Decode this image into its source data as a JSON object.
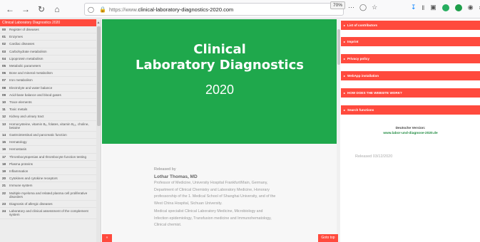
{
  "browser": {
    "url_prefix": "https://www.",
    "url_domain": "clinical-laboratory-diagnostics-2020.com",
    "zoom": "70%",
    "back_icon": "arrow-left-icon",
    "forward_icon": "arrow-right-icon",
    "reload_icon": "reload-icon",
    "home_icon": "home-icon"
  },
  "sidebar": {
    "header": "Clinical Laboratory Diagnostics 2020",
    "items": [
      {
        "num": "00",
        "label": "Register of diseases"
      },
      {
        "num": "01",
        "label": "Enzymes"
      },
      {
        "num": "02",
        "label": "Cardiac diseases"
      },
      {
        "num": "03",
        "label": "Carbohydrate metabolism"
      },
      {
        "num": "04",
        "label": "Lipoprotein metabolism"
      },
      {
        "num": "05",
        "label": "Metabolic parameters"
      },
      {
        "num": "06",
        "label": "Bone and mineral metabolism"
      },
      {
        "num": "07",
        "label": "Iron metabolism"
      },
      {
        "num": "08",
        "label": "Electrolyte and water balance"
      },
      {
        "num": "09",
        "label": "Acid-base balance and blood gases"
      },
      {
        "num": "10",
        "label": "Trace elements"
      },
      {
        "num": "11",
        "label": "Toxic metals"
      },
      {
        "num": "12",
        "label": "Kidney and urinary tract"
      },
      {
        "num": "13",
        "label": "Homocysteine, vitamin B₆, folates, vitamin B₁₂, choline, betaine"
      },
      {
        "num": "14",
        "label": "Gastrointestinal and pancreatic function"
      },
      {
        "num": "15",
        "label": "Hematology"
      },
      {
        "num": "16",
        "label": "Hemostasis"
      },
      {
        "num": "17",
        "label": "Thrombocytopenias and thrombocyte function testing"
      },
      {
        "num": "18",
        "label": "Plasma proteins"
      },
      {
        "num": "19",
        "label": "Inflammation"
      },
      {
        "num": "20",
        "label": "Cytokines and cytokine receptors"
      },
      {
        "num": "21",
        "label": "Immune system"
      },
      {
        "num": "22",
        "label": "Multiple myeloma and related plasma cell proliferative disorders"
      },
      {
        "num": "23",
        "label": "Diagnosis of allergic diseases"
      },
      {
        "num": "24",
        "label": "Laboratory and clinical assessment of the complement system"
      }
    ]
  },
  "hero": {
    "line1": "Clinical",
    "line2": "Laboratory Diagnostics",
    "line3": "2020",
    "color": "#1fa84c"
  },
  "content": {
    "released_by": "Released by",
    "author": "Lothar Thomas, MD",
    "bio1": "Professor of Medicine, University Hospital Frankfurt/Main, Germany,",
    "bio2": "Department of Clinical Chemistry and Laboratory Medicine, Honorary",
    "bio3": "professorship of the 1. Medical School of Shanghai University, and of the",
    "bio4": "West China Hospital, Sichuan University.",
    "bio5": "Medical specialist Clinical Laboratory Medicine, Microbiology and",
    "bio6": "Infection epidemiology, Transfusion medicine and Immunohematology,",
    "bio7": "Clinical chemist."
  },
  "buttons": {
    "left": "«",
    "goto_top": "Goto top"
  },
  "right": {
    "items": [
      "List of contributors",
      "Imprint",
      "Privacy policy",
      "WebApp installation",
      "HOW DOES THE WEBSITE WORK?",
      "Search functions"
    ],
    "german_label": "Deutsche Version:",
    "german_url": "www.labor-und-diagnose-2020.de",
    "released": "Released 03/12/2020"
  },
  "accent": "#ff4a3d"
}
